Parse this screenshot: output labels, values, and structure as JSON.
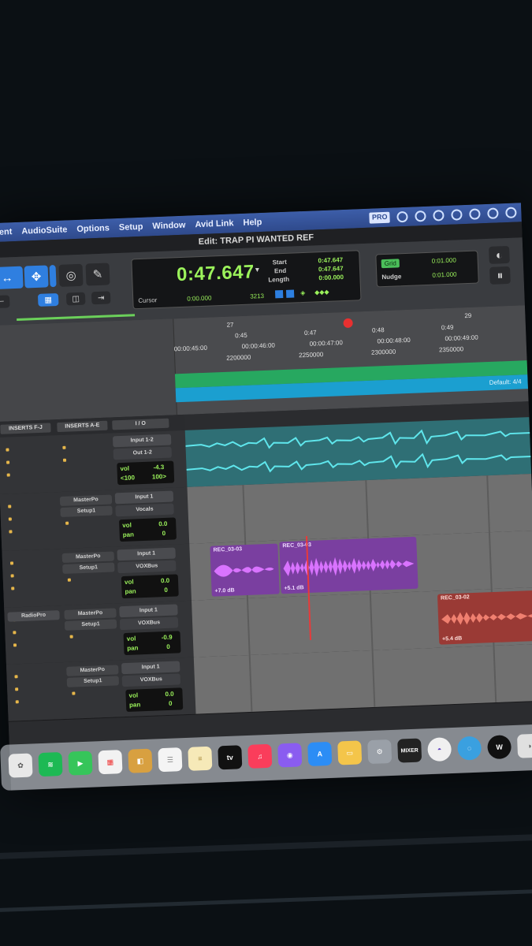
{
  "menubar": {
    "items": [
      "ent",
      "AudioSuite",
      "Options",
      "Setup",
      "Window",
      "Avid Link",
      "Help"
    ],
    "status_badge": "PRO"
  },
  "window": {
    "title": "Edit: TRAP PI WANTED REF"
  },
  "counter": {
    "main": "0:47.647",
    "start_label": "Start",
    "end_label": "End",
    "length_label": "Length",
    "start_value": "0:47.647",
    "end_value": "0:47.647",
    "length_value": "0:00.000",
    "cursor_label": "Cursor",
    "cursor_value": "0:00.000",
    "grid_value": "3213"
  },
  "nudge": {
    "tag": "Grid",
    "nudge_label": "Nudge",
    "grid_value": "0:01.000",
    "nudge_value": "0:01.000"
  },
  "rulers": {
    "bars": [
      "27",
      "29"
    ],
    "min_secs": [
      "0:45",
      "0:47",
      "0:48",
      "0:49"
    ],
    "timecode": [
      "00:00:45:00",
      "00:00:46:00",
      "00:00:47:00",
      "00:00:48:00",
      "00:00:49:00"
    ],
    "samples": [
      "2200000",
      "2250000",
      "2300000",
      "2350000"
    ],
    "marker_label": "Default: 4/4"
  },
  "track_headers": [
    "INSERTS F-J",
    "INSERTS A-E",
    "I / O"
  ],
  "tracks": [
    {
      "input": "Input 1-2",
      "output": "Out 1-2",
      "sends": [
        "",
        ""
      ],
      "vol": "-4.3",
      "pan_l": "<100",
      "pan_r": "100>"
    },
    {
      "input": "Input 1",
      "output": "Vocals",
      "sends": [
        "MasterPo",
        "Setup1"
      ],
      "vol": "0.0",
      "pan": "0"
    },
    {
      "input": "Input 1",
      "output": "VOXBus",
      "sends": [
        "MasterPo",
        "Setup1"
      ],
      "vol": "0.0",
      "pan": "0"
    },
    {
      "input": "Input 1",
      "output": "VOXBus",
      "sends": [
        "MasterPo",
        "Setup1"
      ],
      "insert": "RadioPro",
      "vol": "-0.9",
      "pan": "0"
    },
    {
      "input": "Input 1",
      "output": "VOXBus",
      "sends": [
        "MasterPo",
        "Setup1"
      ],
      "vol": "0.0",
      "pan": "0"
    }
  ],
  "vol_label": "vol",
  "pan_label": "pan",
  "clips": [
    {
      "name": "REC_03-03",
      "gain": "+7.0 dB",
      "color": "#7a3fa0"
    },
    {
      "name": "REC_03-03",
      "gain": "+5.1 dB",
      "color": "#7a3fa0"
    },
    {
      "name": "REC_03-02",
      "gain": "+5.4 dB",
      "color": "#9a3a35"
    }
  ],
  "dock": {
    "tv_label": "tv",
    "mixer_label": "MIXER"
  },
  "colors": {
    "counter_green": "#9bf25b",
    "accent_blue": "#2f7fe0",
    "audio_cyan": "#5fe6ec",
    "clip_purple": "#7a3fa0",
    "clip_red": "#9a3a35"
  }
}
